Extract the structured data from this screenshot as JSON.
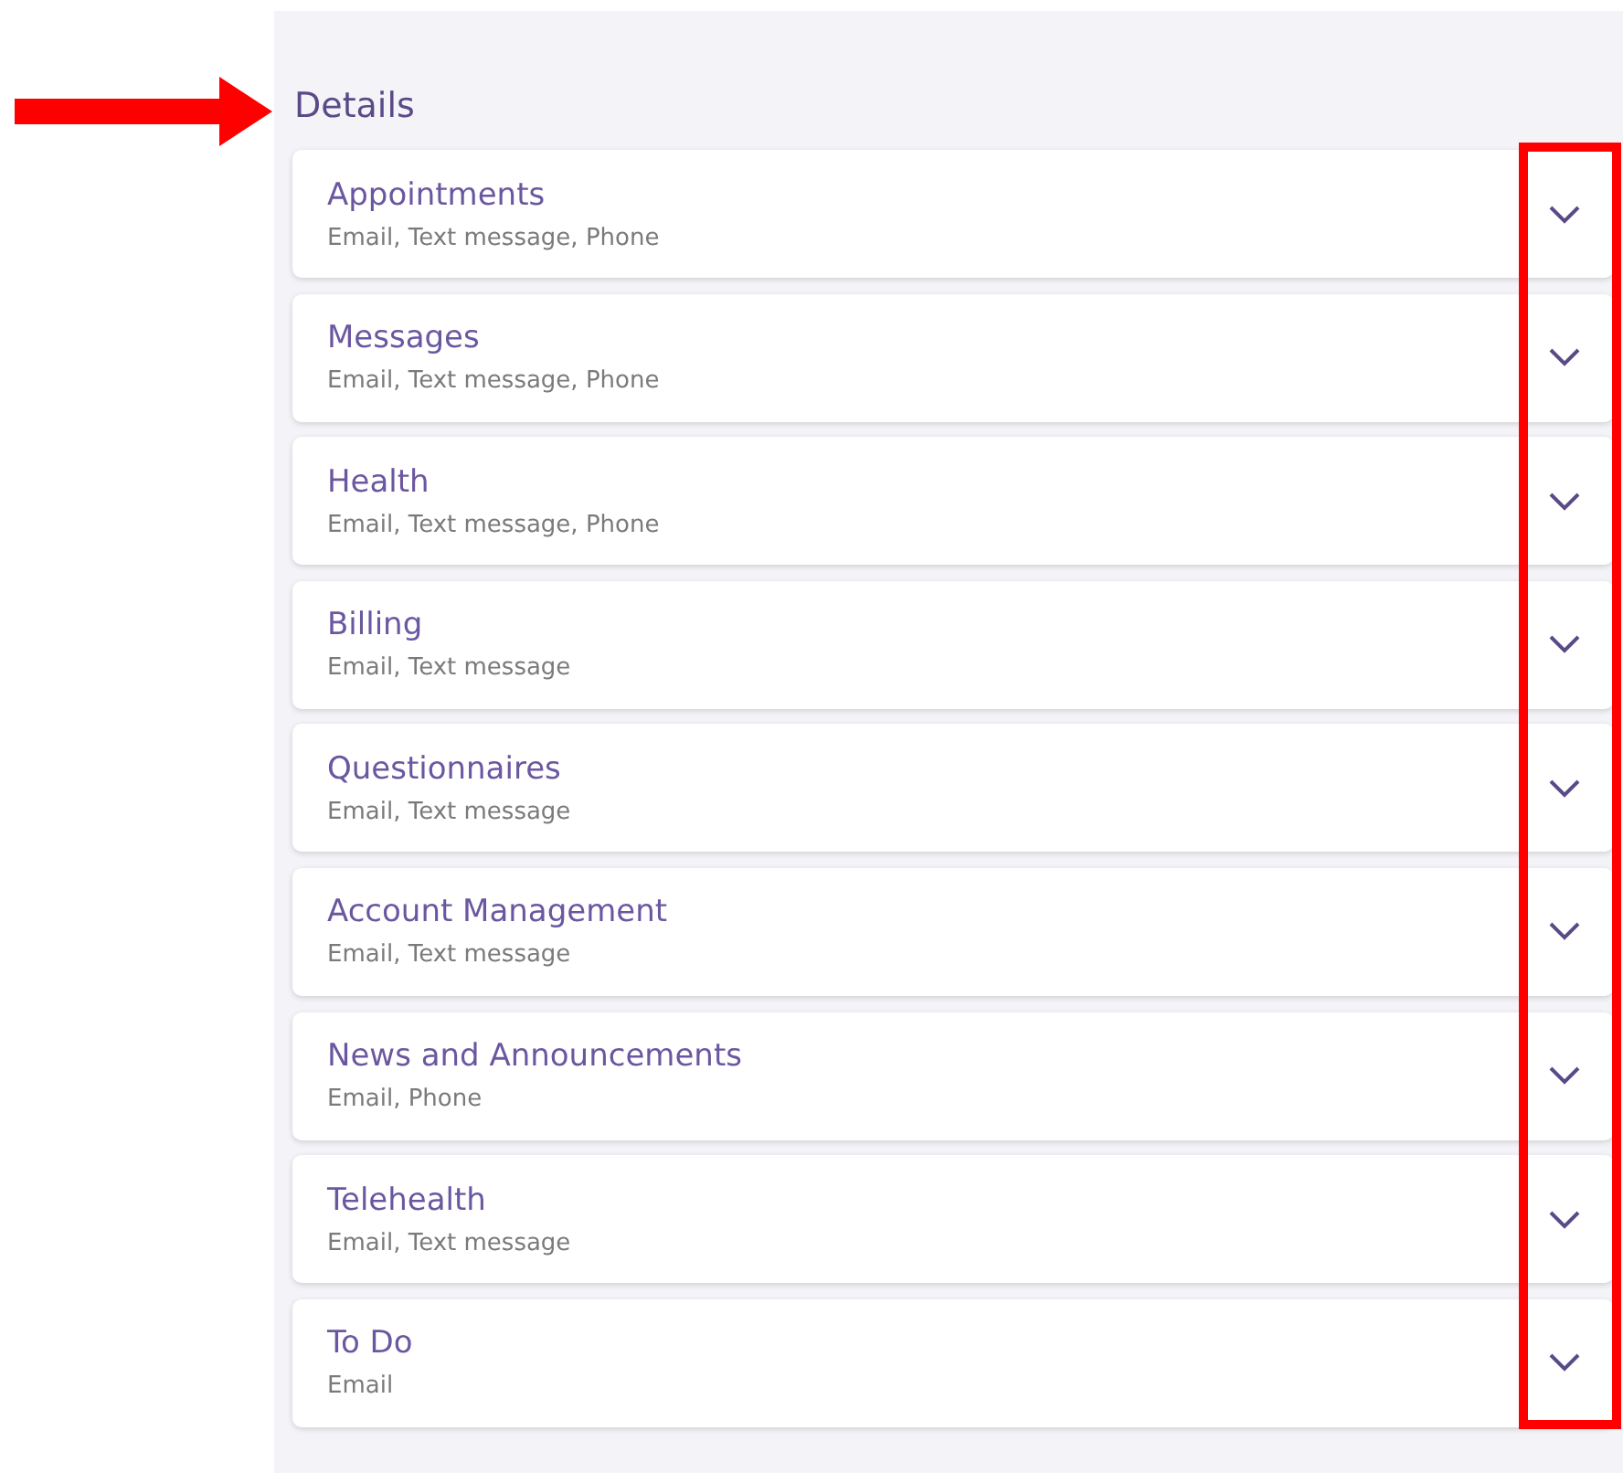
{
  "section_title": "Details",
  "items": [
    {
      "title": "Appointments",
      "channels": "Email, Text message, Phone",
      "expanded": false
    },
    {
      "title": "Messages",
      "channels": "Email, Text message, Phone",
      "expanded": false
    },
    {
      "title": "Health",
      "channels": "Email, Text message, Phone",
      "expanded": false
    },
    {
      "title": "Billing",
      "channels": "Email, Text message",
      "expanded": false
    },
    {
      "title": "Questionnaires",
      "channels": "Email, Text message",
      "expanded": false
    },
    {
      "title": "Account Management",
      "channels": "Email, Text message",
      "expanded": false
    },
    {
      "title": "News and Announcements",
      "channels": "Email, Phone",
      "expanded": false
    },
    {
      "title": "Telehealth",
      "channels": "Email, Text message",
      "expanded": false
    },
    {
      "title": "To Do",
      "channels": "Email",
      "expanded": false
    }
  ]
}
